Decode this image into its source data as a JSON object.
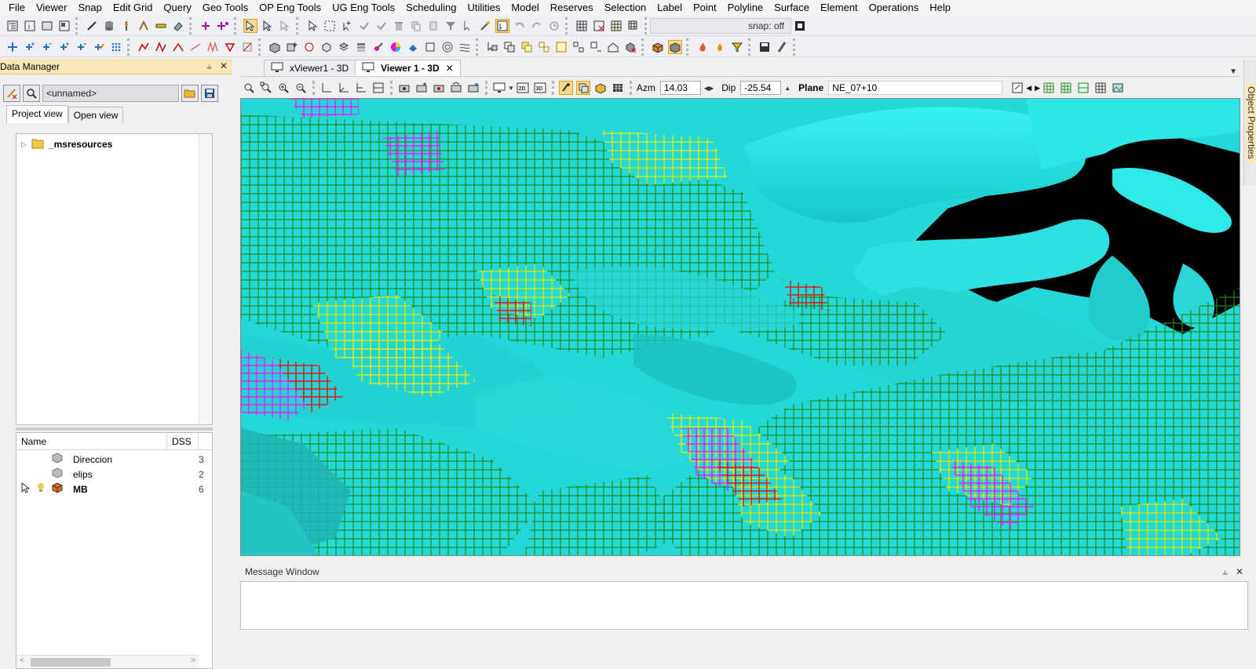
{
  "menu": [
    "File",
    "Viewer",
    "Snap",
    "Edit Grid",
    "Query",
    "Geo Tools",
    "OP Eng Tools",
    "UG Eng Tools",
    "Scheduling",
    "Utilities",
    "Model",
    "Reserves",
    "Selection",
    "Label",
    "Point",
    "Polyline",
    "Surface",
    "Element",
    "Operations",
    "Help"
  ],
  "toolbar": {
    "snap_status": "snap: off"
  },
  "data_manager": {
    "title": "Data Manager",
    "name_field": "<unnamed>",
    "tabs": [
      "Project view",
      "Open view"
    ],
    "tree": [
      {
        "label": "_msresources"
      }
    ],
    "list": {
      "columns": [
        "Name",
        "DSS"
      ],
      "rows": [
        {
          "name": "Direccion",
          "dss": "3"
        },
        {
          "name": "elips",
          "dss": "2"
        },
        {
          "name": "MB",
          "dss": "6"
        }
      ]
    }
  },
  "viewer": {
    "tabs": [
      "xViewer1 - 3D",
      "Viewer 1 - 3D"
    ],
    "azm_label": "Azm",
    "azm_value": "14.03",
    "dip_label": "Dip",
    "dip_value": "-25.54",
    "plane_label": "Plane",
    "plane_value": "NE_07+10"
  },
  "message_window": {
    "title": "Message Window"
  },
  "side_panel": {
    "label": "Object Properties"
  },
  "colors": {
    "cyan": "#21e6e6",
    "green": "#1a8a1a",
    "yellow": "#ffff00",
    "magenta": "#ff00ff",
    "red": "#e01010",
    "panel_title": "#fbe8b7"
  }
}
